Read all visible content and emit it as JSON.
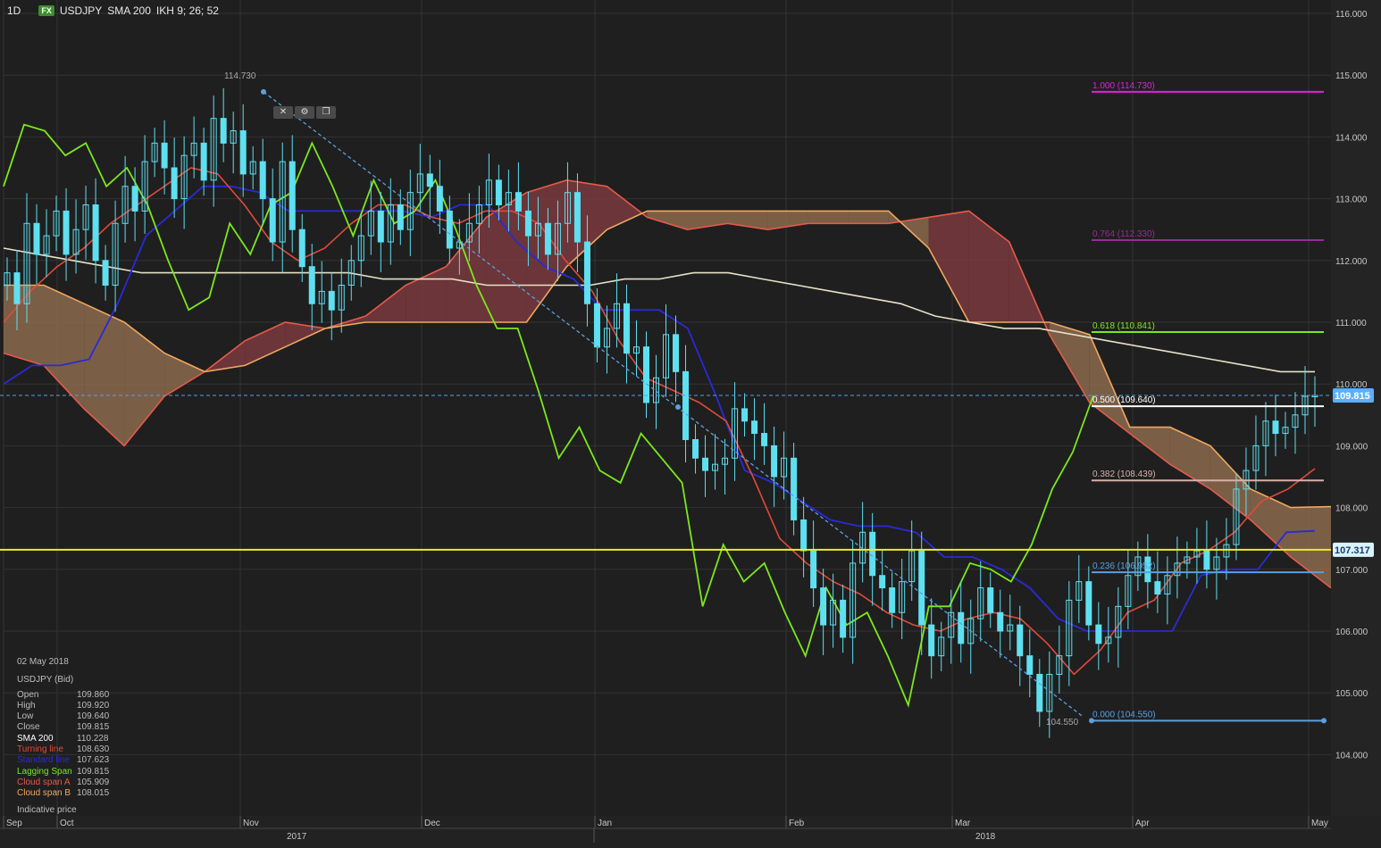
{
  "header": {
    "timeframe": "1D",
    "fx_badge": "FX",
    "symbol": "USDJPY",
    "study1": "SMA 200",
    "study2": "IKH 9; 26; 52"
  },
  "toolbar_icons": [
    "close-icon",
    "gear-icon",
    "copy-icon"
  ],
  "chart_data": {
    "type": "candlestick",
    "price_axis": {
      "min": 103.6,
      "max": 116.0,
      "ticks": [
        "116.000",
        "115.000",
        "114.000",
        "113.000",
        "112.000",
        "111.000",
        "110.000",
        "109.000",
        "108.000",
        "107.000",
        "106.000",
        "105.000",
        "104.000"
      ]
    },
    "time_axis": {
      "months": [
        "Sep",
        "Oct",
        "Nov",
        "Dec",
        "Jan",
        "Feb",
        "Mar",
        "Apr",
        "May"
      ],
      "years": [
        "2017",
        "2018"
      ]
    },
    "current_price": {
      "label": "109.815",
      "value": 109.815
    },
    "horizontal_line": {
      "label": "107.317",
      "value": 107.317
    },
    "swing_high": {
      "label": "114.730",
      "value": 114.73
    },
    "swing_low": {
      "label": "104.550",
      "value": 104.55
    },
    "fibonacci": [
      {
        "label": "1.000 (114.730)",
        "value": 114.73,
        "color": "#e020e0"
      },
      {
        "label": "0.764 (112.330)",
        "value": 112.33,
        "color": "#9a2a9a"
      },
      {
        "label": "0.618 (110.841)",
        "value": 110.841,
        "color": "#7be81c"
      },
      {
        "label": "0.500 (109.640)",
        "value": 109.64,
        "color": "#ffffff"
      },
      {
        "label": "0.382 (108.439)",
        "value": 108.439,
        "color": "#d8b0a8"
      },
      {
        "label": "0.236 (106.952)",
        "value": 106.952,
        "color": "#5aa0e0"
      },
      {
        "label": "0.000 (104.550)",
        "value": 104.55,
        "color": "#5aa0e0"
      }
    ],
    "series": {
      "close": [
        111.8,
        111.3,
        112.6,
        112.1,
        112.4,
        112.8,
        112.1,
        112.5,
        112.9,
        112.0,
        111.6,
        112.6,
        113.2,
        112.8,
        113.6,
        113.9,
        113.5,
        113.0,
        113.7,
        113.9,
        113.3,
        114.3,
        113.9,
        114.1,
        113.4,
        113.6,
        113.0,
        112.3,
        113.6,
        112.5,
        111.9,
        111.3,
        111.5,
        111.2,
        111.6,
        112.0,
        112.4,
        112.8,
        112.3,
        112.9,
        112.5,
        113.1,
        113.4,
        113.2,
        112.8,
        112.2,
        112.3,
        112.6,
        112.9,
        113.3,
        112.9,
        113.1,
        112.8,
        112.4,
        112.6,
        112.1,
        112.6,
        113.1,
        112.3,
        111.3,
        110.6,
        110.9,
        111.3,
        110.5,
        110.6,
        109.7,
        110.1,
        110.8,
        110.2,
        109.1,
        108.8,
        108.6,
        108.7,
        108.8,
        109.6,
        109.4,
        109.2,
        109.0,
        108.5,
        108.8,
        107.8,
        107.3,
        106.7,
        106.1,
        106.5,
        105.9,
        107.1,
        107.6,
        106.9,
        106.7,
        106.3,
        106.8,
        107.3,
        106.1,
        105.6,
        105.9,
        106.3,
        105.8,
        106.2,
        106.7,
        106.3,
        106.0,
        106.1,
        105.6,
        105.3,
        104.7,
        105.3,
        105.6,
        106.5,
        106.8,
        106.1,
        105.8,
        105.9,
        106.4,
        106.9,
        107.2,
        106.8,
        106.6,
        106.9,
        107.1,
        107.2,
        107.3,
        107.0,
        107.2,
        107.4,
        108.3,
        108.6,
        109.0,
        109.4,
        109.2,
        109.3,
        109.5,
        109.8,
        109.815
      ],
      "sma200": [
        112.2,
        112.1,
        112.0,
        111.9,
        111.8,
        111.8,
        111.8,
        111.8,
        111.8,
        111.8,
        111.8,
        111.7,
        111.7,
        111.7,
        111.6,
        111.6,
        111.6,
        111.6,
        111.7,
        111.7,
        111.8,
        111.8,
        111.7,
        111.6,
        111.5,
        111.4,
        111.3,
        111.1,
        111.0,
        110.9,
        110.9,
        110.8,
        110.7,
        110.6,
        110.5,
        110.4,
        110.3,
        110.2,
        110.2
      ],
      "turning_line": [
        111.0,
        111.5,
        111.9,
        112.2,
        112.6,
        112.9,
        113.2,
        113.5,
        113.4,
        112.9,
        112.3,
        112.0,
        112.2,
        112.6,
        112.9,
        112.9,
        112.7,
        112.6,
        112.8,
        112.8,
        112.6,
        112.0,
        111.5,
        110.7,
        110.1,
        109.9,
        109.7,
        109.4,
        108.5,
        107.5,
        107.1,
        106.8,
        106.6,
        106.3,
        106.1,
        106.0,
        106.2,
        106.3,
        106.2,
        105.8,
        105.3,
        105.7,
        106.3,
        106.5,
        107.1,
        107.3,
        107.6,
        108.1,
        108.3,
        108.63
      ],
      "standard_line": [
        110.0,
        110.3,
        110.3,
        110.4,
        111.3,
        112.4,
        112.8,
        113.2,
        113.2,
        113.1,
        112.8,
        112.8,
        112.8,
        112.8,
        112.8,
        112.7,
        112.9,
        112.9,
        112.3,
        111.9,
        111.7,
        111.2,
        111.2,
        111.2,
        110.9,
        109.8,
        108.6,
        108.4,
        108.1,
        107.8,
        107.7,
        107.7,
        107.6,
        107.2,
        107.2,
        107.0,
        106.7,
        106.2,
        106.0,
        106.0,
        106.0,
        106.0,
        106.9,
        107.0,
        107.0,
        107.6,
        107.623
      ],
      "lagging_span": [
        113.2,
        114.2,
        114.1,
        113.7,
        113.9,
        113.2,
        113.5,
        112.9,
        112.0,
        111.2,
        111.4,
        112.6,
        112.1,
        112.9,
        113.1,
        113.9,
        113.2,
        112.4,
        113.3,
        112.6,
        112.8,
        113.3,
        112.5,
        111.6,
        110.9,
        110.9,
        109.9,
        108.8,
        109.3,
        108.6,
        108.4,
        109.2,
        108.8,
        108.4,
        106.4,
        107.4,
        106.8,
        107.1,
        106.3,
        105.6,
        106.7,
        106.1,
        106.3,
        105.6,
        104.8,
        106.4,
        106.4,
        107.1,
        107.0,
        106.8,
        107.4,
        108.3,
        108.9,
        109.815
      ],
      "cloud_span_a": [
        110.5,
        110.3,
        109.6,
        109.0,
        109.8,
        110.2,
        110.7,
        111.0,
        110.9,
        111.1,
        111.6,
        111.9,
        112.7,
        113.1,
        113.3,
        113.2,
        112.7,
        112.5,
        112.6,
        112.5,
        112.6,
        112.6,
        112.6,
        112.7,
        112.8,
        112.3,
        110.8,
        109.7,
        109.2,
        108.7,
        108.3,
        107.8,
        107.2,
        106.7,
        106.3,
        105.909
      ],
      "cloud_span_b": [
        111.6,
        111.6,
        111.3,
        111.0,
        110.5,
        110.2,
        110.3,
        110.6,
        110.9,
        111.0,
        111.0,
        111.0,
        111.0,
        111.0,
        111.9,
        112.5,
        112.8,
        112.8,
        112.8,
        112.8,
        112.8,
        112.8,
        112.8,
        112.2,
        111.0,
        111.0,
        111.0,
        110.8,
        109.3,
        109.3,
        109.0,
        108.3,
        108.0,
        108.015
      ]
    },
    "legend": "none"
  },
  "info_panel": {
    "date": "02 May 2018",
    "instrument": "USDJPY (Bid)",
    "rows": [
      {
        "label": "Open",
        "value": "109.860",
        "color": "#bdbdbd"
      },
      {
        "label": "High",
        "value": "109.920",
        "color": "#bdbdbd"
      },
      {
        "label": "Low",
        "value": "109.640",
        "color": "#bdbdbd"
      },
      {
        "label": "Close",
        "value": "109.815",
        "color": "#bdbdbd"
      },
      {
        "label": "SMA 200",
        "value": "110.228",
        "color": "#ffffff"
      },
      {
        "label": "Turning line",
        "value": "108.630",
        "color": "#e04a3a"
      },
      {
        "label": "Standard line",
        "value": "107.623",
        "color": "#2a2ad8"
      },
      {
        "label": "Lagging Span",
        "value": "109.815",
        "color": "#7be81c"
      },
      {
        "label": "Cloud span A",
        "value": "105.909",
        "color": "#e55a4a"
      },
      {
        "label": "Cloud span B",
        "value": "108.015",
        "color": "#f0a860"
      }
    ],
    "footer": "Indicative price"
  },
  "colors": {
    "background": "#1f1f1f",
    "grid": "#333333",
    "candle": "#5fe0f0",
    "sma": "#e8e0c8",
    "turning": "#e04a3a",
    "standard": "#2a2ad8",
    "lagging": "#7be81c",
    "cloud_bull": "#8c6a4e",
    "cloud_bear": "#7a3a3e",
    "hline": "#e8f020",
    "trend": "#5aa0e0"
  }
}
